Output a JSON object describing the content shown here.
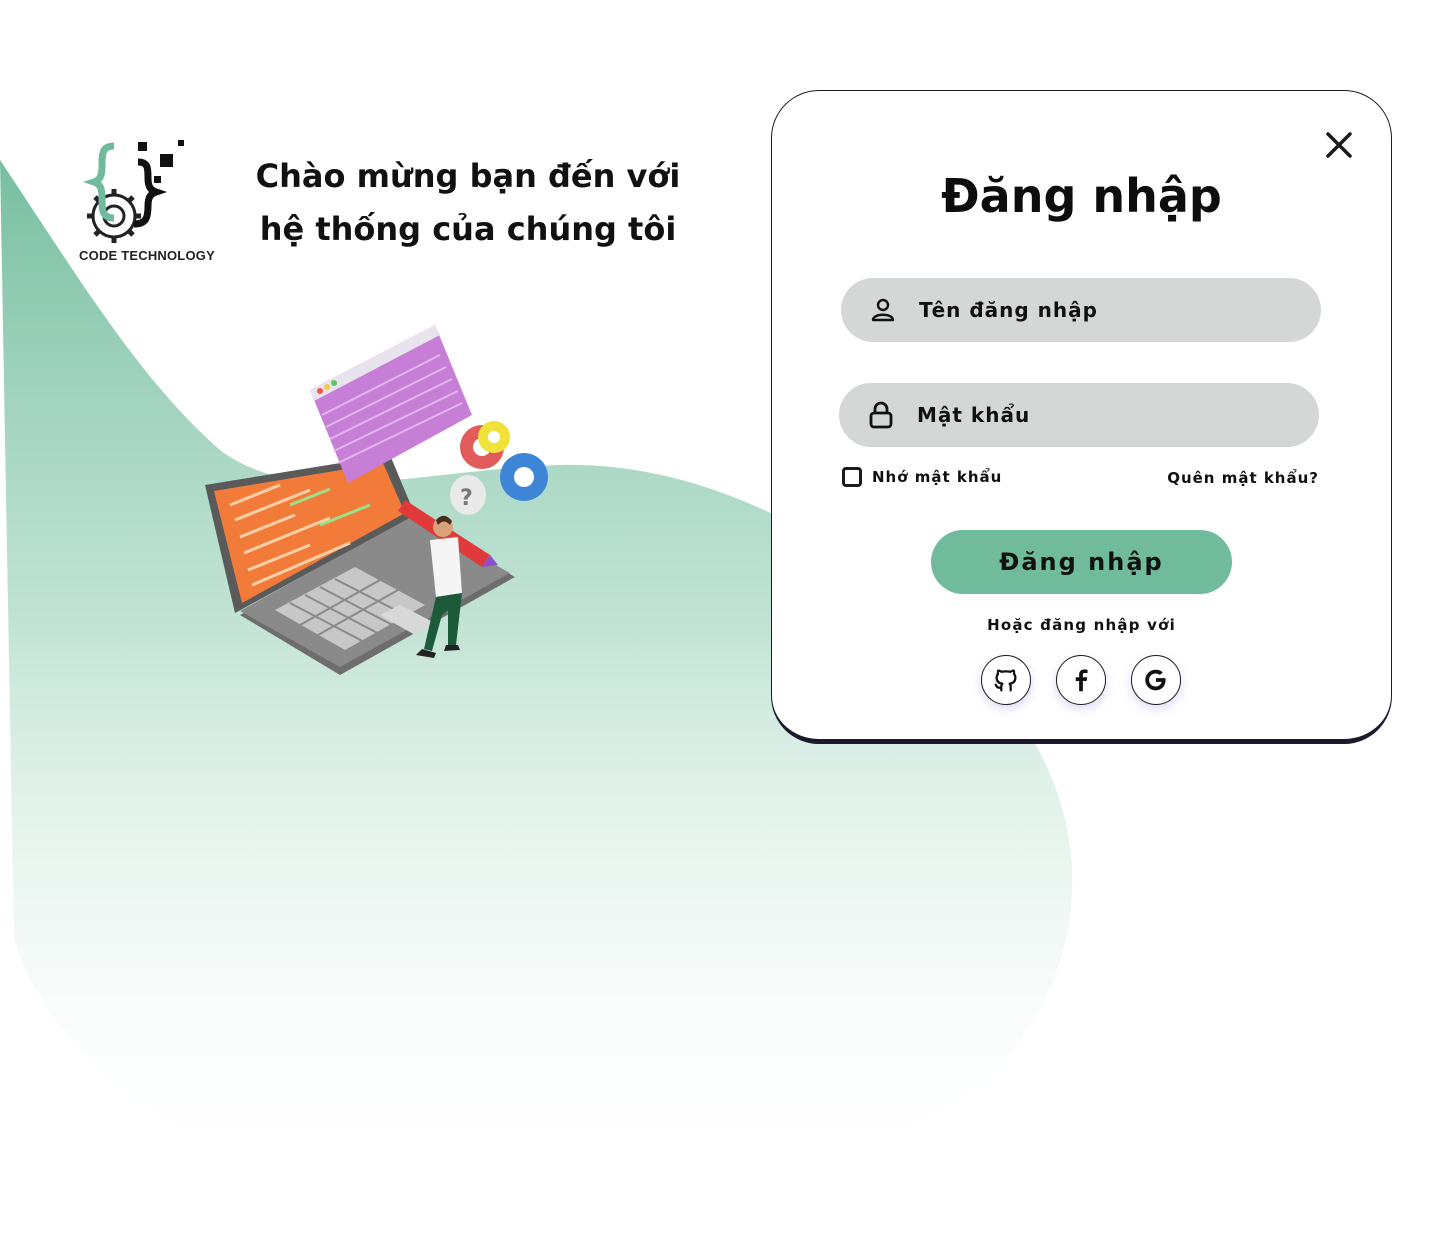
{
  "brand": {
    "logo_text": "CODE TECHNOLOGY"
  },
  "welcome": {
    "line1": "Chào mừng bạn đến với",
    "line2": "hệ thống của chúng tôi"
  },
  "login": {
    "title": "Đăng nhập",
    "username_placeholder": "Tên đăng nhập",
    "password_placeholder": "Mật khẩu",
    "remember_label": "Nhớ mật khẩu",
    "forgot_label": "Quên mật khẩu?",
    "submit_label": "Đăng nhập",
    "alt_login_text": "Hoặc đăng nhập với",
    "social_icons": [
      "github-icon",
      "facebook-icon",
      "google-icon"
    ]
  },
  "colors": {
    "accent": "#70bb9c",
    "input_bg": "#d4d7d6",
    "text": "#111111",
    "card_border": "#1a1a2a"
  }
}
